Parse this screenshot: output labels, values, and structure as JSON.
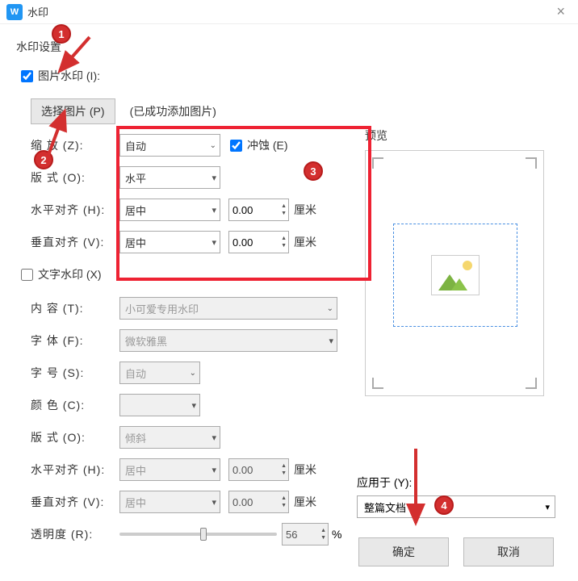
{
  "titlebar": {
    "app_icon_letter": "W",
    "title": "水印"
  },
  "section_title": "水印设置",
  "image_wm": {
    "checkbox_label": "图片水印 (I):",
    "checked": true,
    "choose_btn": "选择图片 (P)",
    "hint": "(已成功添加图片)",
    "zoom_label": "缩    放 (Z):",
    "zoom_value": "自动",
    "erode_label": "冲蚀 (E)",
    "layout_label": "版    式 (O):",
    "layout_value": "水平",
    "halign_label": "水平对齐 (H):",
    "halign_value": "居中",
    "halign_num": "0.00",
    "valign_label": "垂直对齐 (V):",
    "valign_value": "居中",
    "valign_num": "0.00",
    "unit": "厘米"
  },
  "text_wm": {
    "checkbox_label": "文字水印 (X)",
    "content_label": "内    容 (T):",
    "content_value": "小可爱专用水印",
    "font_label": "字    体 (F):",
    "font_value": "微软雅黑",
    "size_label": "字    号 (S):",
    "size_value": "自动",
    "color_label": "颜    色 (C):",
    "layout_label": "版    式 (O):",
    "layout_value": "倾斜",
    "halign_label": "水平对齐 (H):",
    "halign_value": "居中",
    "halign_num": "0.00",
    "valign_label": "垂直对齐 (V):",
    "valign_value": "居中",
    "valign_num": "0.00",
    "opacity_label": "透明度 (R):",
    "opacity_value": "56",
    "unit": "厘米",
    "pct": "%"
  },
  "preview_title": "预览",
  "apply": {
    "label": "应用于 (Y):",
    "value": "整篇文档"
  },
  "footer": {
    "ok": "确定",
    "cancel": "取消"
  },
  "annotations": {
    "n1": "1",
    "n2": "2",
    "n3": "3",
    "n4": "4"
  }
}
